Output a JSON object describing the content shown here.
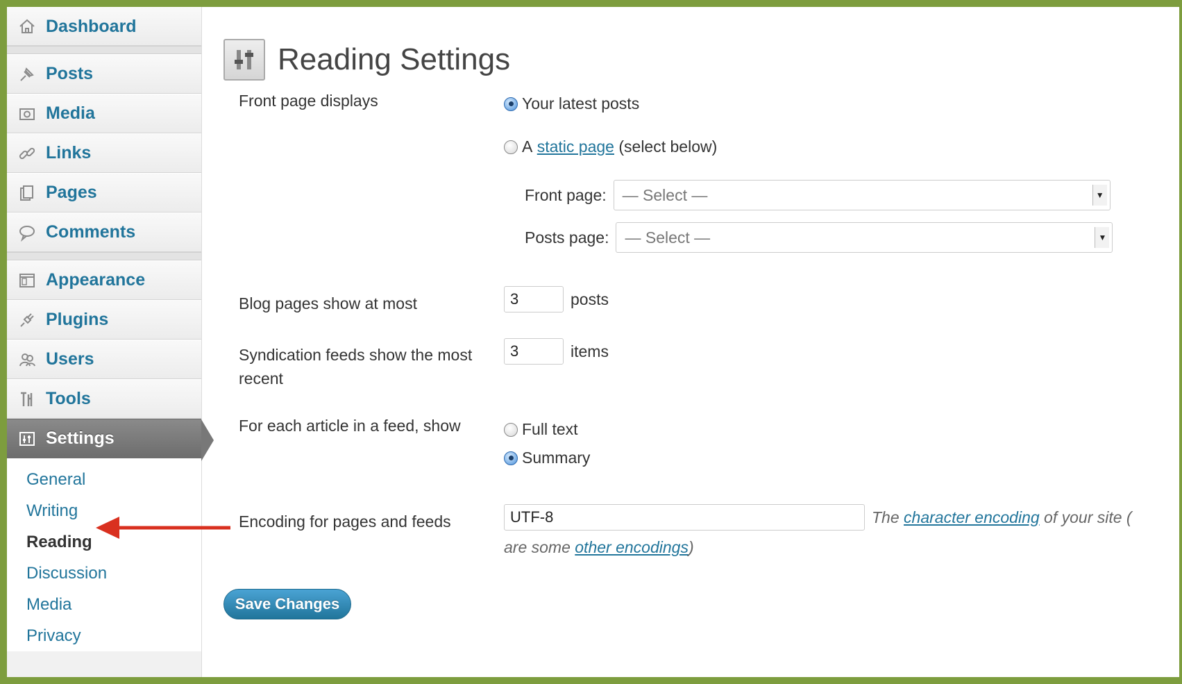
{
  "sidebar": {
    "items": [
      {
        "label": "Dashboard",
        "icon": "home-icon"
      },
      {
        "label": "Posts",
        "icon": "pin-icon"
      },
      {
        "label": "Media",
        "icon": "media-icon"
      },
      {
        "label": "Links",
        "icon": "link-icon"
      },
      {
        "label": "Pages",
        "icon": "pages-icon"
      },
      {
        "label": "Comments",
        "icon": "comment-icon"
      },
      {
        "label": "Appearance",
        "icon": "appearance-icon"
      },
      {
        "label": "Plugins",
        "icon": "plug-icon"
      },
      {
        "label": "Users",
        "icon": "users-icon"
      },
      {
        "label": "Tools",
        "icon": "tools-icon"
      },
      {
        "label": "Settings",
        "icon": "settings-icon"
      }
    ],
    "submenu": [
      "General",
      "Writing",
      "Reading",
      "Discussion",
      "Media",
      "Privacy"
    ]
  },
  "page": {
    "title": "Reading Settings"
  },
  "front_page": {
    "label": "Front page displays",
    "option_latest": "Your latest posts",
    "option_static_prefix": "A",
    "option_static_link": "static page",
    "option_static_suffix": "(select below)",
    "front_page_label": "Front page:",
    "front_page_value": "— Select —",
    "posts_page_label": "Posts page:",
    "posts_page_value": "— Select —"
  },
  "blog_pages": {
    "label": "Blog pages show at most",
    "value": "3",
    "unit": "posts"
  },
  "syndication": {
    "label": "Syndication feeds show the most recent",
    "value": "3",
    "unit": "items"
  },
  "feed_article": {
    "label": "For each article in a feed, show",
    "option_full": "Full text",
    "option_summary": "Summary",
    "selected": "Summary"
  },
  "encoding": {
    "label": "Encoding for pages and feeds",
    "value": "UTF-8",
    "desc_prefix": "The",
    "desc_link": "character encoding",
    "desc_suffix": "of your site (",
    "desc2_prefix": "are some",
    "desc2_link": "other encodings",
    "desc2_suffix": ")"
  },
  "actions": {
    "save_label": "Save Changes"
  },
  "colors": {
    "frame": "#7d9d3e",
    "link": "#21759b",
    "annotation_arrow": "#d9301f"
  }
}
